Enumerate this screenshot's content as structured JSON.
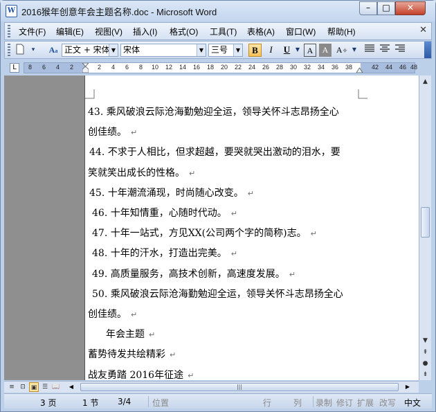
{
  "window": {
    "title": "2016猴年创意年会主题名称.doc - Microsoft Word"
  },
  "menu": {
    "items": [
      "文件(F)",
      "编辑(E)",
      "视图(V)",
      "插入(I)",
      "格式(O)",
      "工具(T)",
      "表格(A)",
      "窗口(W)",
      "帮助(H)"
    ]
  },
  "toolbar": {
    "style_value": "正文 + 宋体",
    "font_value": "宋体",
    "size_value": "三号",
    "bold_label": "B",
    "italic_label": "I",
    "underline_label": "U"
  },
  "ruler": {
    "ticks": [
      "8",
      "6",
      "4",
      "2",
      "",
      "2",
      "4",
      "6",
      "8",
      "10",
      "12",
      "14",
      "16",
      "18",
      "20",
      "22",
      "24",
      "26",
      "28",
      "30",
      "32",
      "34",
      "36",
      "38",
      "40",
      "",
      "42",
      "44",
      "46",
      "48"
    ]
  },
  "document": {
    "lines": [
      {
        "text": "43. 乘风破浪云际沧海勤勉迎全运，领导关怀斗志昂扬全心",
        "indent": 4
      },
      {
        "text": "创佳绩。",
        "indent": 4,
        "pm": "↵"
      },
      {
        "text": "44. 不求于人相比，但求超越，要哭就哭出激动的泪水，要",
        "indent": 6
      },
      {
        "text": "笑就笑出成长的性格。",
        "indent": 4,
        "pm": "↵"
      },
      {
        "text": "45. 十年潮流涌现，时尚随心改变。",
        "indent": 6,
        "pm": "↵"
      },
      {
        "text": "46. 十年知情重，心随时代动。",
        "indent": 10,
        "pm": "↵"
      },
      {
        "text": "47. 十年一站式，方见XX(公司两个字的简称)志。",
        "indent": 10,
        "pm": "↵"
      },
      {
        "text": "48. 十年的汗水，打造出完美。",
        "indent": 10,
        "pm": "↵"
      },
      {
        "text": "49. 高质量服务，高技术创新，高速度发展。",
        "indent": 10,
        "pm": "↵"
      },
      {
        "text": "50. 乘风破浪云际沧海勤勉迎全运，领导关怀斗志昂扬全心",
        "indent": 10
      },
      {
        "text": "创佳绩。",
        "indent": 4,
        "pm": "↵"
      },
      {
        "text": "年会主题",
        "indent": 30,
        "pm": "↵"
      },
      {
        "text": "蓄势待发共绘精彩",
        "indent": 4,
        "pm": "↵"
      },
      {
        "text": "战友勇踏 2016年征途",
        "indent": 4,
        "pm": "↵"
      }
    ]
  },
  "status": {
    "page": "3 页",
    "section": "1 节",
    "page_of": "3/4",
    "position": "位置",
    "line": "行",
    "column": "列",
    "record": "录制",
    "revise": "修订",
    "extend": "扩展",
    "overwrite": "改写",
    "language": "中文"
  }
}
